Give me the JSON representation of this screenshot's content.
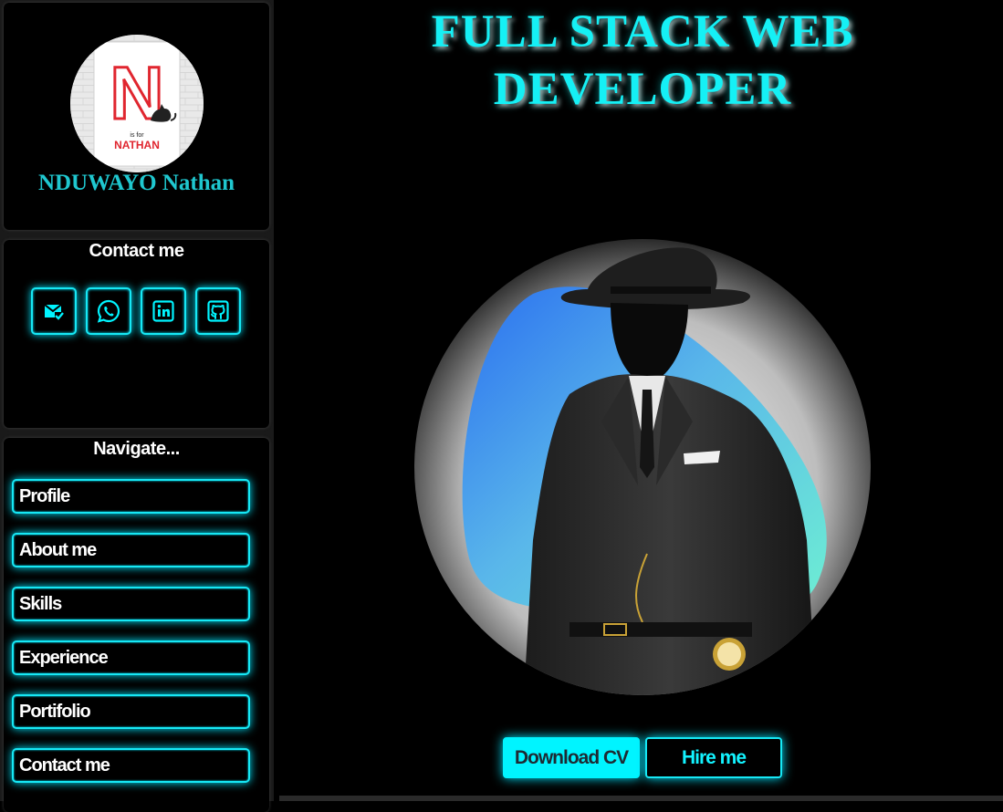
{
  "colors": {
    "accent": "#00f4ff",
    "name_text": "#1fc7cf",
    "background": "#000000"
  },
  "profile": {
    "name": "NDUWAYO Nathan",
    "avatar": {
      "letter": "N",
      "small_text": "is for",
      "word": "NATHAN"
    }
  },
  "contact": {
    "heading": "Contact me",
    "icons": [
      "email-check-icon",
      "whatsapp-icon",
      "linkedin-icon",
      "github-icon"
    ]
  },
  "nav": {
    "heading": "Navigate...",
    "items": [
      {
        "label": "Profile"
      },
      {
        "label": "About me"
      },
      {
        "label": "Skills"
      },
      {
        "label": "Experience"
      },
      {
        "label": "Portifolio"
      },
      {
        "label": "Contact me"
      }
    ]
  },
  "hero": {
    "title_line1": "FULL STACK WEB",
    "title_line2": "DEVELOPER"
  },
  "actions": {
    "download_cv": "Download CV",
    "hire_me": "Hire me"
  }
}
